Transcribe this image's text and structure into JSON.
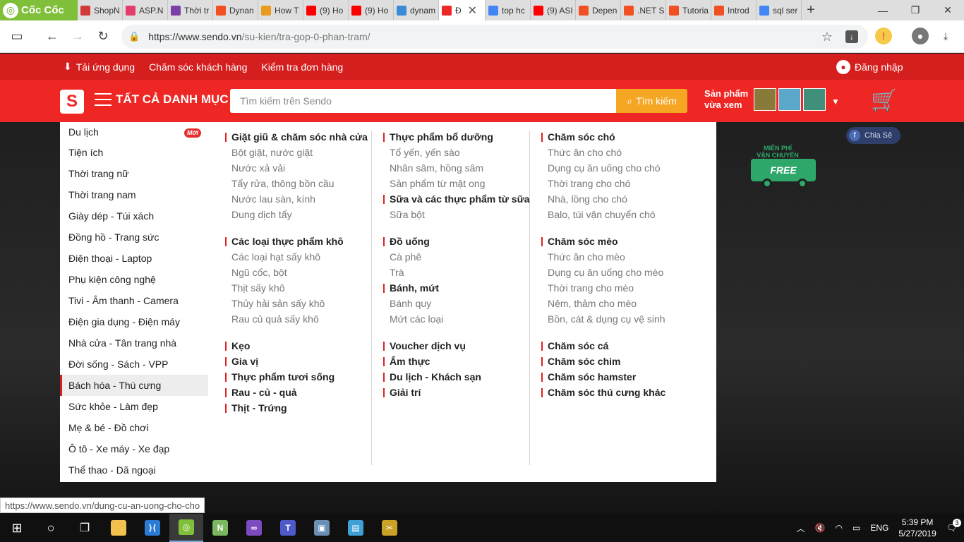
{
  "browser": {
    "brand": "Cốc Cốc",
    "tabs": [
      {
        "label": "ShopN",
        "color": "#d33b3b"
      },
      {
        "label": "ASP.N",
        "color": "#e23d6b"
      },
      {
        "label": "Thời tr",
        "color": "#7b3fa8"
      },
      {
        "label": "Dynan",
        "color": "#f25022"
      },
      {
        "label": "How T",
        "color": "#e89b1c"
      },
      {
        "label": "(9) Ho",
        "color": "#ff0000"
      },
      {
        "label": "(9) Ho",
        "color": "#ff0000"
      },
      {
        "label": "dynam",
        "color": "#3b8bd8"
      },
      {
        "label": "Đ",
        "color": "#ee2624",
        "active": true
      },
      {
        "label": "top hc",
        "color": "#4285f4"
      },
      {
        "label": "(9) ASI",
        "color": "#ff0000"
      },
      {
        "label": "Depen",
        "color": "#f25022"
      },
      {
        "label": ".NET S",
        "color": "#f25022"
      },
      {
        "label": "Tutoria",
        "color": "#f25022"
      },
      {
        "label": "Introd",
        "color": "#f25022"
      },
      {
        "label": "sql ser",
        "color": "#4285f4"
      }
    ],
    "url_host": "https://www.sendo.vn",
    "url_path": "/su-kien/tra-gop-0-phan-tram/",
    "status_url": "https://www.sendo.vn/dung-cu-an-uong-cho-cho"
  },
  "header": {
    "top_links": [
      "Tải ứng dụng",
      "Chăm sóc khách hàng",
      "Kiểm tra đơn hàng"
    ],
    "login": "Đăng nhập",
    "all_categories": "TẤT CẢ DANH MỤC",
    "search_placeholder": "Tìm kiếm trên Sendo",
    "search_button": "Tìm kiếm",
    "viewed_line1": "Sản phẩm",
    "viewed_line2": "vừa xem"
  },
  "hero": {
    "share": "Chia Sẻ",
    "free_line1": "MIỄN PHÍ",
    "free_line2": "VẬN CHUYỂN",
    "free_word": "FREE"
  },
  "categories": [
    {
      "label": "Du lịch",
      "badge": "Mới"
    },
    {
      "label": "Tiện ích"
    },
    {
      "label": "Thời trang nữ"
    },
    {
      "label": "Thời trang nam"
    },
    {
      "label": "Giày dép - Túi xách"
    },
    {
      "label": "Đồng hồ - Trang sức"
    },
    {
      "label": "Điện thoại - Laptop"
    },
    {
      "label": "Phụ kiện công nghệ"
    },
    {
      "label": "Tivi - Âm thanh - Camera"
    },
    {
      "label": "Điện gia dụng - Điện máy"
    },
    {
      "label": "Nhà cửa - Tân trang nhà"
    },
    {
      "label": "Đời sống - Sách - VPP"
    },
    {
      "label": "Bách hóa - Thú cưng",
      "active": true
    },
    {
      "label": "Sức khỏe - Làm đẹp"
    },
    {
      "label": "Mẹ & bé - Đồ chơi"
    },
    {
      "label": "Ô tô - Xe máy - Xe đạp"
    },
    {
      "label": "Thể thao - Dã ngoại"
    }
  ],
  "columns": [
    [
      {
        "title": "Giặt giũ & chăm sóc nhà cửa",
        "items": [
          "Bột giặt, nước giặt",
          "Nước xả vải",
          "Tẩy rửa, thông bồn cầu",
          "Nước lau sàn, kính",
          "Dung dịch tẩy"
        ]
      },
      {
        "title": "Các loại thực phẩm khô",
        "items": [
          "Các loại hạt sấy khô",
          "Ngũ cốc, bột",
          "Thịt sấy khô",
          "Thủy hải sản sấy khô",
          "Rau củ quả sấy khô"
        ]
      },
      {
        "title": "Kẹo",
        "items": [],
        "compact": true
      },
      {
        "title": "Gia vị",
        "items": [],
        "compact": true
      },
      {
        "title": "Thực phẩm tươi sống",
        "items": [],
        "compact": true
      },
      {
        "title": "Rau - củ - quả",
        "items": [],
        "compact": true
      },
      {
        "title": "Thịt - Trứng",
        "items": [],
        "compact": true
      }
    ],
    [
      {
        "title": "Thực phẩm bổ dưỡng",
        "items": [
          "Tổ yến, yến sào",
          "Nhân sâm, hồng sâm",
          "Sản phẩm từ mật ong"
        ],
        "compact": true
      },
      {
        "title": "Sữa và các thực phẩm từ sữa",
        "items": [
          "Sữa bột"
        ]
      },
      {
        "title": "Đồ uống",
        "items": [
          "Cà phê",
          "Trà"
        ],
        "compact": true
      },
      {
        "title": "Bánh, mứt",
        "items": [
          "Bánh quy",
          "Mứt các loại"
        ]
      },
      {
        "title": "Voucher dịch vụ",
        "items": [],
        "compact": true
      },
      {
        "title": "Ẩm thực",
        "items": [],
        "compact": true
      },
      {
        "title": "Du lịch - Khách sạn",
        "items": [],
        "compact": true
      },
      {
        "title": "Giải trí",
        "items": [],
        "compact": true
      }
    ],
    [
      {
        "title": "Chăm sóc chó",
        "items": [
          "Thức ăn cho chó",
          "Dụng cụ ăn uống cho chó",
          "Thời trang cho chó",
          "Nhà, lồng cho chó",
          "Balo, túi vận chuyển chó"
        ]
      },
      {
        "title": "Chăm sóc mèo",
        "items": [
          "Thức ăn cho mèo",
          "Dụng cụ ăn uống cho mèo",
          "Thời trang cho mèo",
          "Nệm, thảm cho mèo",
          "Bồn, cát & dụng cụ vệ sinh"
        ]
      },
      {
        "title": "Chăm sóc cá",
        "items": [],
        "compact": true
      },
      {
        "title": "Chăm sóc chim",
        "items": [],
        "compact": true
      },
      {
        "title": "Chăm sóc hamster",
        "items": [],
        "compact": true
      },
      {
        "title": "Chăm sóc thú cưng khác",
        "items": [],
        "compact": true
      }
    ]
  ],
  "taskbar": {
    "apps": [
      {
        "name": "file-explorer",
        "color": "#f2c14e",
        "label": ""
      },
      {
        "name": "vscode",
        "color": "#2b7bd6",
        "label": "⟩⟨"
      },
      {
        "name": "coccoc",
        "color": "#7fbf3a",
        "label": "◎",
        "active": true
      },
      {
        "name": "notepadpp",
        "color": "#7bb661",
        "label": "N"
      },
      {
        "name": "visual-studio",
        "color": "#7b4bbf",
        "label": "∞"
      },
      {
        "name": "teams",
        "color": "#5059c9",
        "label": "T"
      },
      {
        "name": "control-panel",
        "color": "#6a8fb5",
        "label": "▣"
      },
      {
        "name": "notebook",
        "color": "#3fa0d6",
        "label": "▤"
      },
      {
        "name": "snipping-tool",
        "color": "#c9a227",
        "label": "✂"
      }
    ],
    "lang": "ENG",
    "time": "5:39 PM",
    "date": "5/27/2019",
    "notif_count": "3"
  }
}
